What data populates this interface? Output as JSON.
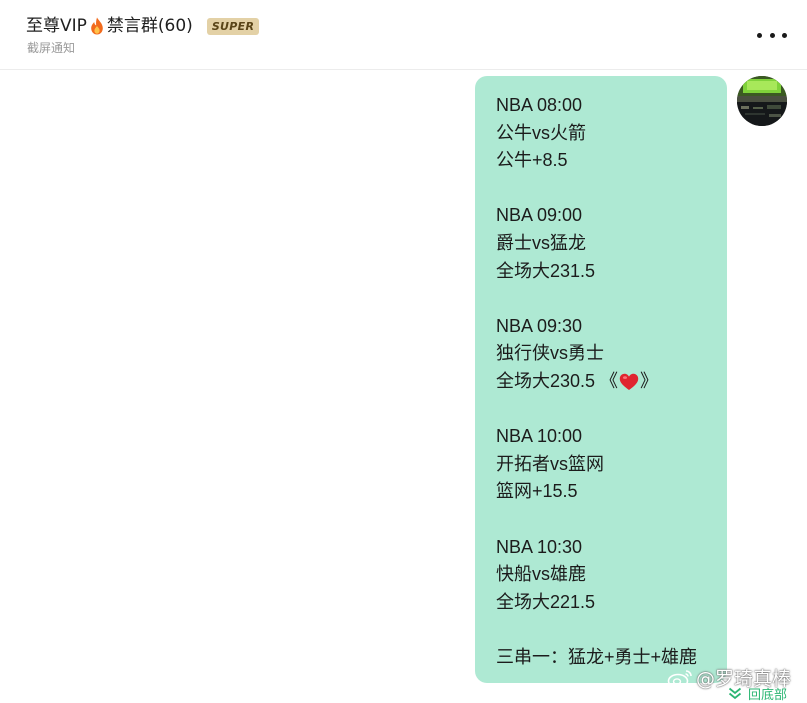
{
  "header": {
    "title_prefix": "至尊VIP",
    "title_suffix": "禁言群(60)",
    "title_icon": "fire-icon",
    "badge": "SUPER",
    "subtitle": "截屏通知",
    "more_icon": "more-dots-icon"
  },
  "message": {
    "lines": [
      "NBA 08:00",
      "公牛vs火箭",
      "公牛+8.5",
      "",
      "NBA 09:00",
      "爵士vs猛龙",
      "全场大231.5",
      "",
      "NBA 09:30",
      "独行侠vs勇士",
      "",
      "",
      "NBA 10:00",
      "开拓者vs篮网",
      "篮网+15.5",
      "",
      "NBA 10:30",
      "快船vs雄鹿",
      "全场大221.5",
      "",
      "三串一：猛龙+勇士+雄鹿"
    ],
    "heart_line": {
      "before": "全场大230.5 《",
      "icon": "heart-icon",
      "after": "》"
    },
    "bubble_color": "#aee9d3"
  },
  "watermark": {
    "icon": "weibo-icon",
    "text": "@罗琦真棒"
  },
  "scroll_to_bottom": {
    "icon": "double-chevron-down-icon",
    "label": "回底部",
    "color": "#2bb673"
  }
}
